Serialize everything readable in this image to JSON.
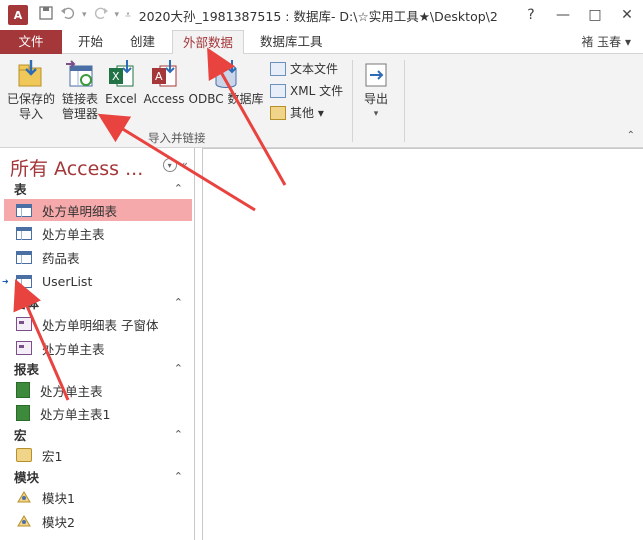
{
  "window": {
    "title": "2020大孙_1981387515 : 数据库- D:\\☆实用工具★\\Desktop\\2...",
    "app_icon_letter": "A",
    "help": "?",
    "minimize": "—",
    "restore": "□",
    "close": "✕"
  },
  "tabs": [
    {
      "label": "文件"
    },
    {
      "label": "开始"
    },
    {
      "label": "创建"
    },
    {
      "label": "外部数据"
    },
    {
      "label": "数据库工具"
    }
  ],
  "user": "褚 玉春 ▾",
  "ribbon": {
    "saved_imports": "已保存的\n导入",
    "linked_table_manager": "链接表\n管理器",
    "excel": "Excel",
    "access": "Access",
    "odbc": "ODBC 数据库",
    "text_file": "文本文件",
    "xml_file": "XML 文件",
    "more": "其他 ▾",
    "import_group": "导入并链接",
    "export": "导出"
  },
  "nav": {
    "header": "所有 Access ...",
    "sections": {
      "tables": "表",
      "forms": "窗体",
      "reports": "报表",
      "macros": "宏",
      "modules": "模块"
    },
    "items": {
      "t1": "处方单明细表",
      "t2": "处方单主表",
      "t3": "药品表",
      "t4": "UserList",
      "f1": "处方单明细表 子窗体",
      "f2": "处方单主表",
      "r1": "处方单主表",
      "r2": "处方单主表1",
      "m1": "宏1",
      "mod1": "模块1",
      "mod2": "模块2"
    }
  },
  "colors": {
    "accent": "#a4373a",
    "selection": "#f5a9aa",
    "arrow": "#e8433f"
  }
}
